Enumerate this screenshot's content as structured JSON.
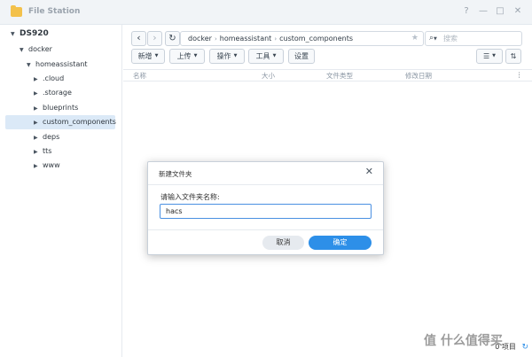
{
  "window": {
    "title": "File Station"
  },
  "titlebar": {
    "controls": [
      "?",
      "—",
      "□",
      "✕"
    ]
  },
  "sidebar": {
    "items": [
      {
        "label": "DS920",
        "level": 0,
        "expanded": true
      },
      {
        "label": "docker",
        "level": 1,
        "expanded": true
      },
      {
        "label": "homeassistant",
        "level": 2,
        "expanded": true
      },
      {
        "label": ".cloud",
        "level": 3
      },
      {
        "label": ".storage",
        "level": 3
      },
      {
        "label": "blueprints",
        "level": 3
      },
      {
        "label": "custom_components",
        "level": 3,
        "selected": true
      },
      {
        "label": "deps",
        "level": 3
      },
      {
        "label": "tts",
        "level": 3
      },
      {
        "label": "www",
        "level": 3
      }
    ]
  },
  "toolbar": {
    "back": "‹",
    "forward": "›",
    "refresh": "↻",
    "path": [
      "docker",
      "homeassistant",
      "custom_components"
    ],
    "search_placeholder": "搜索",
    "buttons": {
      "new": "新增",
      "upload": "上传",
      "action": "操作",
      "tools": "工具",
      "settings": "设置"
    }
  },
  "columns": [
    "名称",
    "大小",
    "文件类型",
    "修改日期"
  ],
  "status": {
    "items_text": "0 项目"
  },
  "dialog": {
    "title": "新建文件夹",
    "label": "请输入文件夹名称:",
    "input_value": "hacs",
    "cancel": "取消",
    "ok": "确定"
  },
  "watermark": {
    "text": "什么值得买"
  },
  "colors": {
    "accent": "#2d8fe8",
    "selection": "#dbe9f7"
  }
}
